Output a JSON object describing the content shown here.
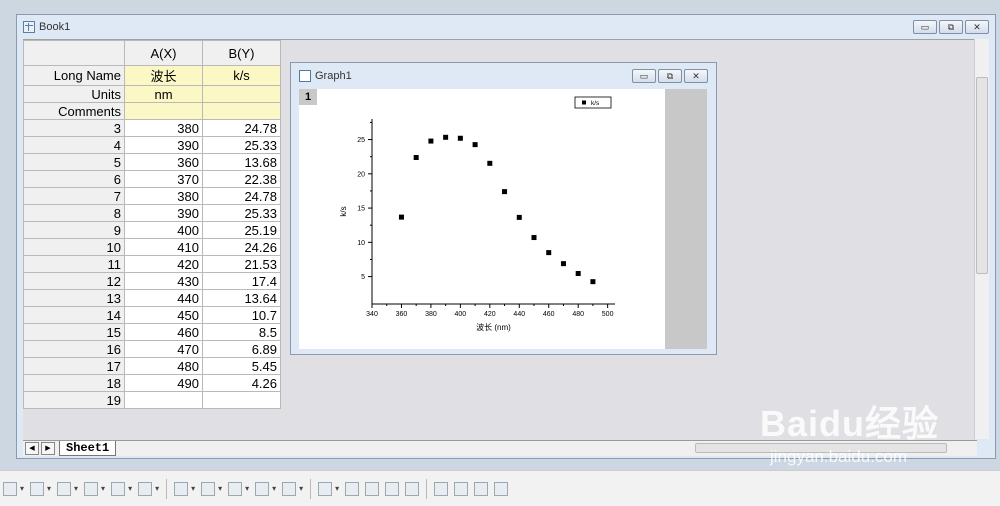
{
  "book": {
    "title": "Book1",
    "btn_min": "▭",
    "btn_restore": "⧉",
    "btn_close": "✕"
  },
  "graph": {
    "title": "Graph1",
    "layer_number": "1",
    "btn_min": "▭",
    "btn_restore": "⧉",
    "btn_close": "✕"
  },
  "sheet": {
    "columns": [
      "A(X)",
      "B(Y)"
    ],
    "meta_rows": [
      {
        "label": "Long Name",
        "a": "波长",
        "b": "k/s"
      },
      {
        "label": "Units",
        "a": "nm",
        "b": ""
      },
      {
        "label": "Comments",
        "a": "",
        "b": ""
      }
    ],
    "rows": [
      {
        "n": "3",
        "a": "380",
        "b": "24.78"
      },
      {
        "n": "4",
        "a": "390",
        "b": "25.33"
      },
      {
        "n": "5",
        "a": "360",
        "b": "13.68"
      },
      {
        "n": "6",
        "a": "370",
        "b": "22.38"
      },
      {
        "n": "7",
        "a": "380",
        "b": "24.78"
      },
      {
        "n": "8",
        "a": "390",
        "b": "25.33"
      },
      {
        "n": "9",
        "a": "400",
        "b": "25.19"
      },
      {
        "n": "10",
        "a": "410",
        "b": "24.26"
      },
      {
        "n": "11",
        "a": "420",
        "b": "21.53"
      },
      {
        "n": "12",
        "a": "430",
        "b": "17.4"
      },
      {
        "n": "13",
        "a": "440",
        "b": "13.64"
      },
      {
        "n": "14",
        "a": "450",
        "b": "10.7"
      },
      {
        "n": "15",
        "a": "460",
        "b": "8.5"
      },
      {
        "n": "16",
        "a": "470",
        "b": "6.89"
      },
      {
        "n": "17",
        "a": "480",
        "b": "5.45"
      },
      {
        "n": "18",
        "a": "490",
        "b": "4.26"
      },
      {
        "n": "19",
        "a": "",
        "b": ""
      }
    ],
    "tab": "Sheet1"
  },
  "chart_data": {
    "type": "scatter",
    "xlabel": "波长 (nm)",
    "ylabel": "k/s",
    "xlim": [
      340,
      505
    ],
    "ylim": [
      1,
      28
    ],
    "xticks": [
      "340",
      "360",
      "380",
      "400",
      "420",
      "440",
      "460",
      "480",
      "500"
    ],
    "yticks": [
      "5",
      "10",
      "15",
      "20",
      "25"
    ],
    "legend": "k/s",
    "legend_position": "top-right",
    "series": [
      {
        "name": "k/s",
        "x": [
          360,
          370,
          380,
          390,
          400,
          410,
          420,
          430,
          440,
          450,
          460,
          470,
          480,
          490
        ],
        "y": [
          13.68,
          22.38,
          24.78,
          25.33,
          25.19,
          24.26,
          21.53,
          17.4,
          13.64,
          10.7,
          8.5,
          6.89,
          5.45,
          4.26
        ]
      }
    ]
  },
  "toolbar": {
    "icons": [
      "line-plot-icon",
      "error-bar-icon",
      "area-plot-icon",
      "polar-plot-icon",
      "candlestick-icon",
      "template-icon",
      "layer-icon",
      "stack-icon",
      "merge-icon",
      "grid-icon",
      "panel-icon",
      "align-left-icon",
      "align-right-icon",
      "align-top-icon",
      "align-bottom-icon",
      "distribute-icon",
      "front-icon",
      "back-icon",
      "group-icon",
      "ungroup-icon"
    ]
  },
  "watermark": {
    "logo": "Baidu经验",
    "url": "jingyan.baidu.com"
  }
}
